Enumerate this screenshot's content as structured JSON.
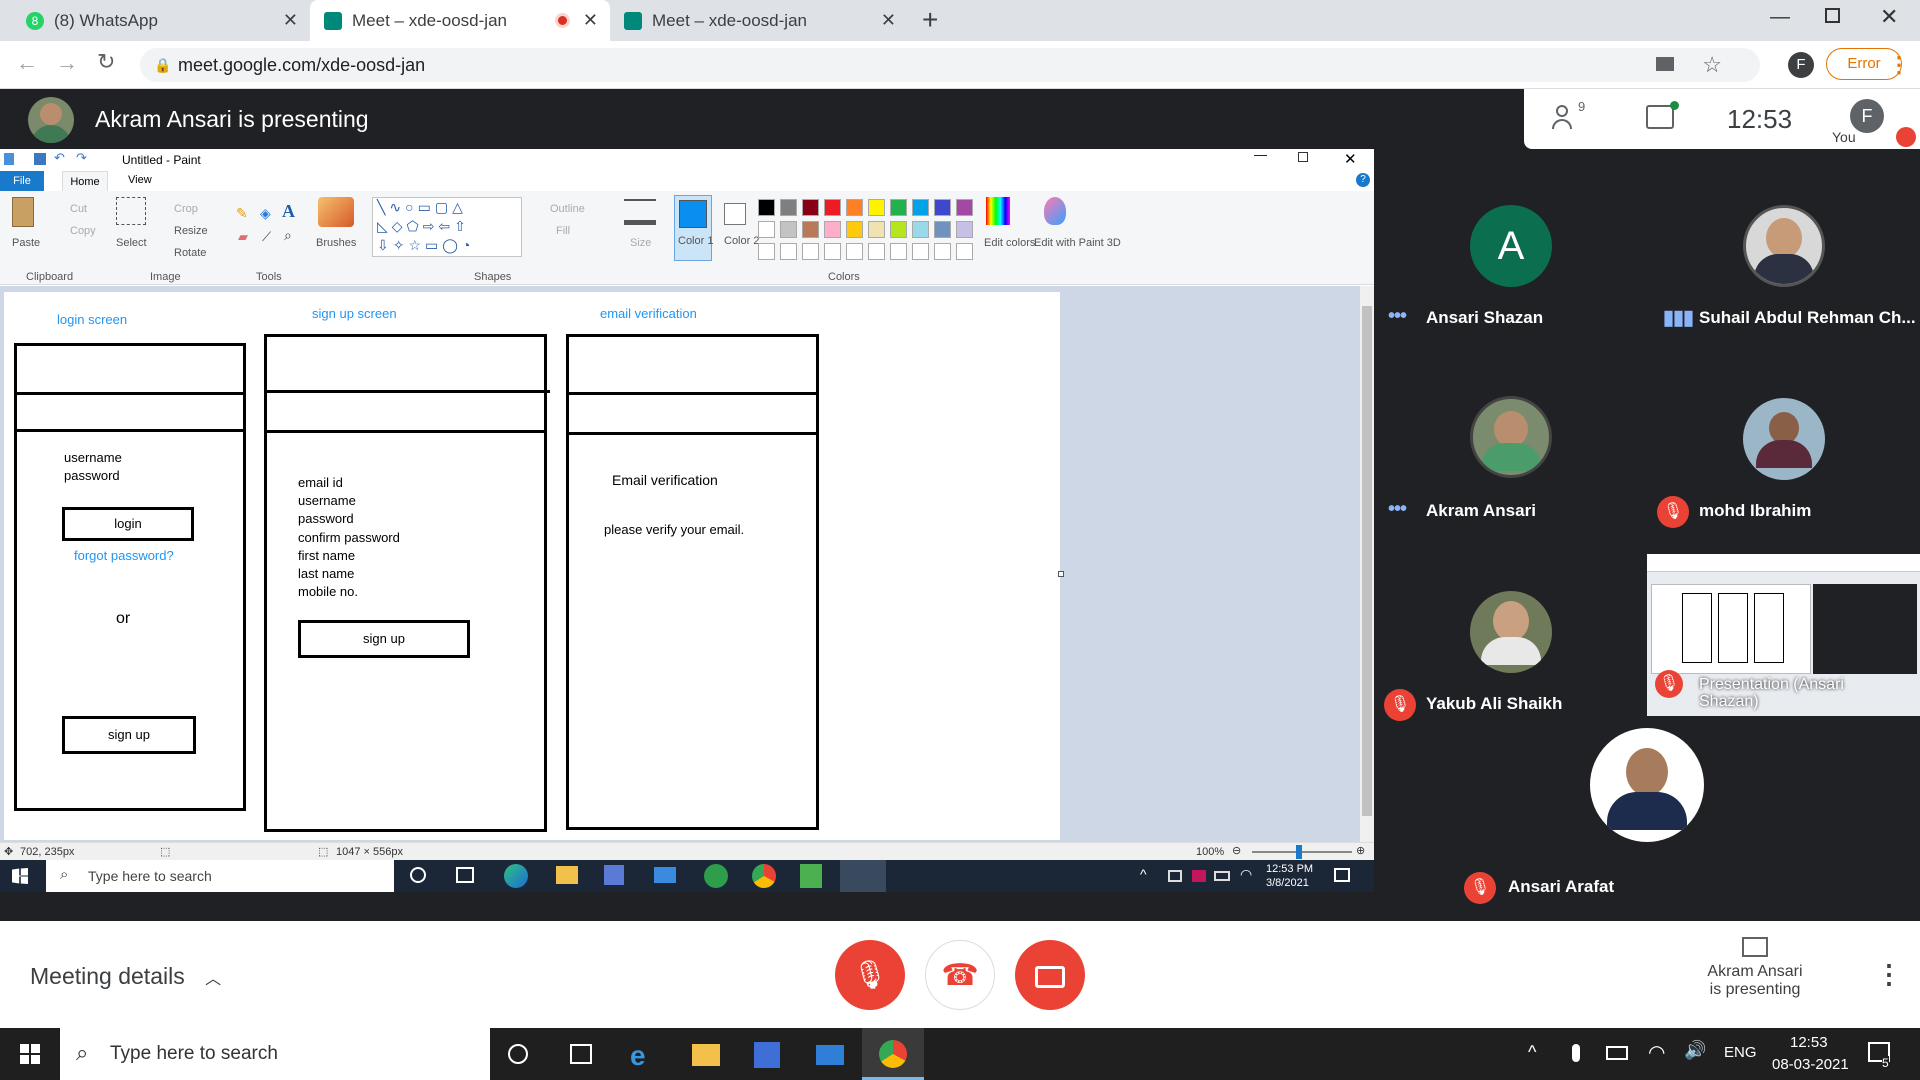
{
  "browser": {
    "tabs": [
      {
        "title": "(8) WhatsApp",
        "badge": "8"
      },
      {
        "title": "Meet – xde-oosd-jan"
      },
      {
        "title": "Meet – xde-oosd-jan"
      }
    ],
    "url": "meet.google.com/xde-oosd-jan",
    "profile_initial": "F",
    "error_label": "Error"
  },
  "meet": {
    "presenting_banner": "Akram Ansari is presenting",
    "people_count": "9",
    "time": "12:53",
    "you_label": "You",
    "you_initial": "F",
    "meeting_details": "Meeting details",
    "present_label_1": "Akram Ansari",
    "present_label_2": "is presenting",
    "participants": [
      {
        "name": "Ansari Shazan",
        "initial": "A",
        "status": "speaking"
      },
      {
        "name": "Suhail Abdul Rehman Ch...",
        "status": "speaking"
      },
      {
        "name": "Akram Ansari",
        "status": "speaking"
      },
      {
        "name": "mohd Ibrahim",
        "status": "muted"
      },
      {
        "name": "Yakub Ali Shaikh",
        "status": "muted"
      },
      {
        "name": "Presentation (Ansari Shazan)",
        "status": "muted"
      },
      {
        "name": "Ansari Arafat",
        "status": "muted"
      }
    ],
    "colors": {
      "accent_red": "#ea4335",
      "avatar_green": "#0b6e4f",
      "speaking_blue": "#8ab4f8"
    }
  },
  "paint": {
    "title": "Untitled - Paint",
    "tabs": [
      "File",
      "Home",
      "View"
    ],
    "clipboard": {
      "paste": "Paste",
      "cut": "Cut",
      "copy": "Copy",
      "group": "Clipboard"
    },
    "image": {
      "select": "Select",
      "crop": "Crop",
      "resize": "Resize",
      "rotate": "Rotate",
      "group": "Image"
    },
    "tools_group": "Tools",
    "brushes": "Brushes",
    "shapes": {
      "outline": "Outline",
      "fill": "Fill",
      "group": "Shapes"
    },
    "size": "Size",
    "color1": "Color 1",
    "color2": "Color 2",
    "colors_group": "Colors",
    "edit_colors": "Edit colors",
    "edit_3d": "Edit with Paint 3D",
    "status_pos": "702, 235px",
    "status_size": "1047 × 556px",
    "zoom": "100%",
    "palette": [
      "#000000",
      "#7f7f7f",
      "#880015",
      "#ed1c24",
      "#ff7f27",
      "#fff200",
      "#22b14c",
      "#00a2e8",
      "#3f48cc",
      "#a349a4",
      "#ffffff",
      "#c3c3c3",
      "#b97a57",
      "#ffaec9",
      "#ffc90e",
      "#efe4b0",
      "#b5e61d",
      "#99d9ea",
      "#7092be",
      "#c8bfe7"
    ]
  },
  "wireframe": {
    "login": {
      "title": "login screen",
      "fields": [
        "username",
        "password"
      ],
      "login_button": "login",
      "forgot": "forgot password?",
      "or": "or",
      "signup_button": "sign up"
    },
    "signup": {
      "title": "sign up screen",
      "fields": [
        "email id",
        "username",
        "password",
        "confirm password",
        "first name",
        "last name",
        "mobile no."
      ],
      "signup_button": "sign up"
    },
    "email": {
      "title": "email verification",
      "heading": "Email verification",
      "message": "please verify your email."
    }
  },
  "inner_taskbar": {
    "search": "Type here to search",
    "time": "12:53 PM",
    "date": "3/8/2021"
  },
  "taskbar": {
    "search": "Type here to search",
    "lang": "ENG",
    "time": "12:53",
    "date": "08-03-2021",
    "notifications": "5"
  }
}
